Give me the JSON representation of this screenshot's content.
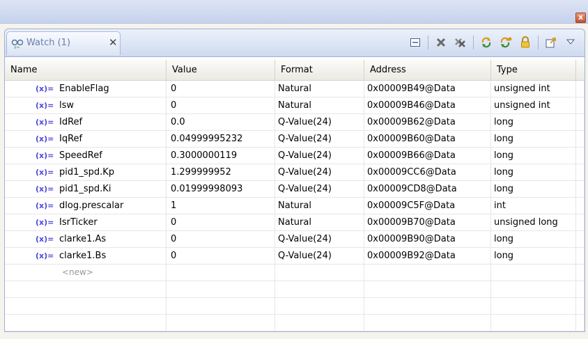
{
  "panel": {
    "close_glyph": "x",
    "tab_label": "Watch (1)",
    "tab_close_glyph": "✕",
    "tab_icon": "watch-glasses-icon"
  },
  "toolbar": {
    "buttons": [
      {
        "icon": "collapse-all-icon"
      },
      {
        "icon": "remove-icon"
      },
      {
        "icon": "remove-all-icon"
      },
      {
        "icon": "refresh-icon"
      },
      {
        "icon": "continuous-refresh-icon"
      },
      {
        "icon": "lock-icon"
      },
      {
        "icon": "export-icon"
      },
      {
        "icon": "view-menu-icon"
      }
    ]
  },
  "table": {
    "columns": [
      "Name",
      "Value",
      "Format",
      "Address",
      "Type"
    ],
    "var_icon_text": "(x)=",
    "rows": [
      {
        "name": "EnableFlag",
        "value": "0",
        "format": "Natural",
        "address": "0x00009B49@Data",
        "type": "unsigned int"
      },
      {
        "name": "lsw",
        "value": "0",
        "format": "Natural",
        "address": "0x00009B46@Data",
        "type": "unsigned int"
      },
      {
        "name": "IdRef",
        "value": "0.0",
        "format": "Q-Value(24)",
        "address": "0x00009B62@Data",
        "type": "long"
      },
      {
        "name": "IqRef",
        "value": "0.04999995232",
        "format": "Q-Value(24)",
        "address": "0x00009B60@Data",
        "type": "long"
      },
      {
        "name": "SpeedRef",
        "value": "0.3000000119",
        "format": "Q-Value(24)",
        "address": "0x00009B66@Data",
        "type": "long"
      },
      {
        "name": "pid1_spd.Kp",
        "value": "1.299999952",
        "format": "Q-Value(24)",
        "address": "0x00009CC6@Data",
        "type": "long"
      },
      {
        "name": "pid1_spd.Ki",
        "value": "0.01999998093",
        "format": "Q-Value(24)",
        "address": "0x00009CD8@Data",
        "type": "long"
      },
      {
        "name": "dlog.prescalar",
        "value": "1",
        "format": "Natural",
        "address": "0x00009C5F@Data",
        "type": "int"
      },
      {
        "name": "IsrTicker",
        "value": "0",
        "format": "Natural",
        "address": "0x00009B70@Data",
        "type": "unsigned long"
      },
      {
        "name": "clarke1.As",
        "value": "0",
        "format": "Q-Value(24)",
        "address": "0x00009B90@Data",
        "type": "long"
      },
      {
        "name": "clarke1.Bs",
        "value": "0",
        "format": "Q-Value(24)",
        "address": "0x00009B92@Data",
        "type": "long"
      }
    ],
    "new_placeholder": "<new>"
  },
  "colors": {
    "accent": "#4a4ad8",
    "tab_label": "#6b7ea8",
    "close_button": "#c4532f"
  }
}
